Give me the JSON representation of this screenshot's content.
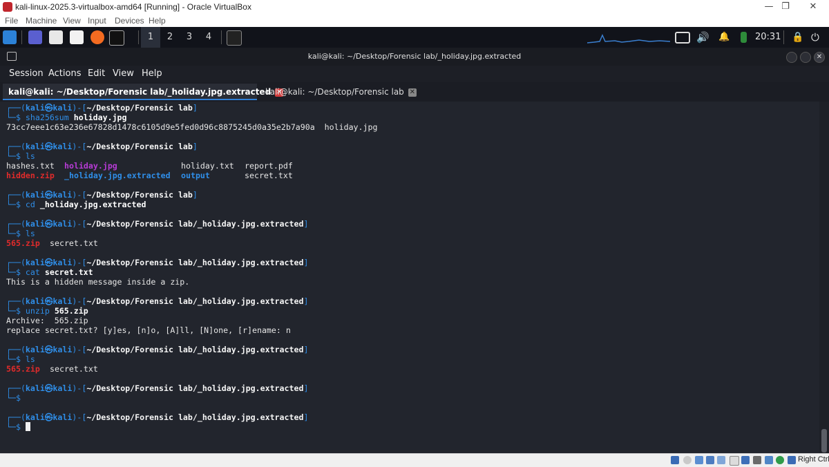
{
  "window": {
    "title": "kali-linux-2025.3-virtualbox-amd64 [Running] - Oracle VirtualBox",
    "controls": {
      "minimize": "—",
      "maximize": "❐",
      "close": "✕"
    }
  },
  "vbox_menu": [
    "File",
    "Machine",
    "View",
    "Input",
    "Devices",
    "Help"
  ],
  "panel": {
    "workspaces": [
      "1",
      "2",
      "3",
      "4"
    ],
    "active_workspace": "1",
    "clock": "20:31"
  },
  "terminal": {
    "title": "kali@kali: ~/Desktop/Forensic lab/_holiday.jpg.extracted",
    "menu": [
      "Session",
      "Actions",
      "Edit",
      "View",
      "Help"
    ],
    "tabs": [
      {
        "label": "kali@kali: ~/Desktop/Forensic lab/_holiday.jpg.extracted",
        "active": true,
        "close": "✕"
      },
      {
        "label": "kali@kali: ~/Desktop/Forensic lab",
        "active": false,
        "close": "✕"
      }
    ],
    "prompt": {
      "open": "┌──(",
      "user": "kali",
      "at": "㉿",
      "host": "kali",
      "mid": ")-[",
      "close": "]",
      "dollar": "└─$ ",
      "path_lab": "~/Desktop/Forensic lab",
      "path_ext": "~/Desktop/Forensic lab/_holiday.jpg.extracted"
    },
    "lines": {
      "c1_cmd": "sha256sum ",
      "c1_arg": "holiday.jpg",
      "o1": "73cc7eee1c63e236e67828d1478c6105d9e5fed0d96c8875245d0a35e2b7a90a  holiday.jpg",
      "c2_cmd": "ls",
      "ls1": {
        "a": "hashes.txt",
        "b": "holiday.jpg",
        "c": "holiday.txt",
        "d": "report.pdf"
      },
      "ls2": {
        "a": "hidden.zip",
        "b": "_holiday.jpg.extracted",
        "c": "output",
        "d": "secret.txt"
      },
      "c3_cmd": "cd ",
      "c3_arg": "_holiday.jpg.extracted",
      "c4_cmd": "ls",
      "ls3": {
        "a": "565.zip",
        "b": "secret.txt"
      },
      "c5_cmd": "cat ",
      "c5_arg": "secret.txt",
      "o5": "This is a hidden message inside a zip.",
      "c6_cmd": "unzip ",
      "c6_arg": "565.zip",
      "o6a": "Archive:  565.zip",
      "o6b": "replace secret.txt? [y]es, [n]o, [A]ll, [N]one, [r]ename: n",
      "c7_cmd": "ls",
      "ls4": {
        "a": "565.zip",
        "b": "secret.txt"
      }
    }
  },
  "status_bar": {
    "host_key": "Right Ctrl"
  }
}
